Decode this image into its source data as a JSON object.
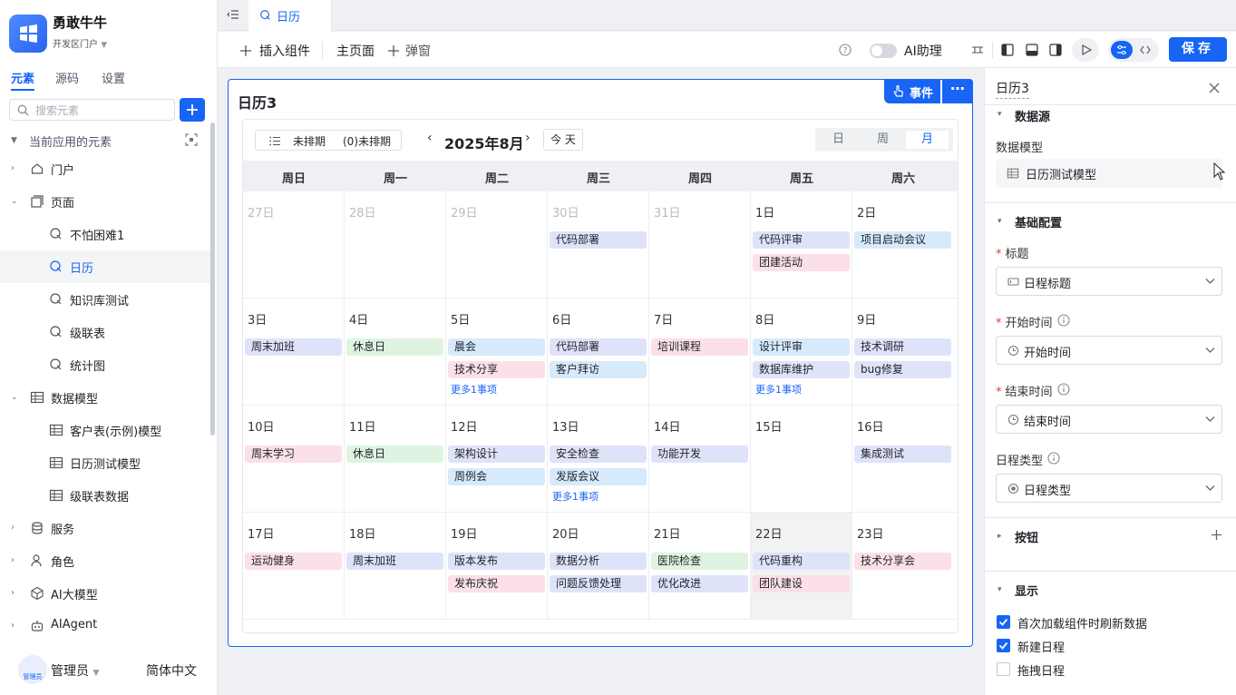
{
  "app": {
    "name": "勇敢牛牛",
    "portal": "开发区门户"
  },
  "left_tabs": [
    {
      "label": "元素"
    },
    {
      "label": "源码"
    },
    {
      "label": "设置"
    }
  ],
  "search": {
    "placeholder": "搜索元素"
  },
  "tree": {
    "section_label": "当前应用的元素",
    "items": [
      {
        "label": "门户"
      },
      {
        "label": "页面"
      },
      {
        "label": "不怕困难1"
      },
      {
        "label": "日历"
      },
      {
        "label": "知识库测试"
      },
      {
        "label": "级联表"
      },
      {
        "label": "统计图"
      },
      {
        "label": "数据模型"
      },
      {
        "label": "客户表(示例)模型"
      },
      {
        "label": "日历测试模型"
      },
      {
        "label": "级联表数据"
      },
      {
        "label": "服务"
      },
      {
        "label": "角色"
      },
      {
        "label": "AI大模型"
      },
      {
        "label": "AIAgent"
      }
    ]
  },
  "footer": {
    "user": "管理员",
    "avatar_text": "管理员",
    "language": "简体中文"
  },
  "tab": {
    "label": "日历"
  },
  "toolbar": {
    "insert": "插入组件",
    "main_page": "主页面",
    "popup": "弹窗",
    "ai_assistant": "AI助理",
    "save": "保存"
  },
  "component": {
    "title": "日历3",
    "event_button": "事件"
  },
  "calendar": {
    "unscheduled_label": "未排期",
    "unscheduled_count": "(0)未排期",
    "month_title": "2025年8月",
    "today_label": "今 天",
    "views": [
      {
        "label": "日"
      },
      {
        "label": "周"
      },
      {
        "label": "月"
      }
    ],
    "active_view": "月",
    "weekdays": [
      {
        "label": "周日"
      },
      {
        "label": "周一"
      },
      {
        "label": "周二"
      },
      {
        "label": "周三"
      },
      {
        "label": "周四"
      },
      {
        "label": "周五"
      },
      {
        "label": "周六"
      }
    ],
    "weeks": [
      [
        {
          "day": "27日",
          "other": true,
          "events": []
        },
        {
          "day": "28日",
          "other": true,
          "events": []
        },
        {
          "day": "29日",
          "other": true,
          "events": []
        },
        {
          "day": "30日",
          "other": true,
          "events": [
            {
              "title": "代码部署",
              "color": "#dfe3f9"
            }
          ]
        },
        {
          "day": "31日",
          "other": true,
          "events": []
        },
        {
          "day": "1日",
          "events": [
            {
              "title": "代码评审",
              "color": "#dfe3f9"
            },
            {
              "title": "团建活动",
              "color": "#fbe0e8"
            }
          ]
        },
        {
          "day": "2日",
          "events": [
            {
              "title": "项目启动会议",
              "color": "#d7eafb"
            }
          ]
        }
      ],
      [
        {
          "day": "3日",
          "events": [
            {
              "title": "周末加班",
              "color": "#dfe3f9"
            }
          ]
        },
        {
          "day": "4日",
          "events": [
            {
              "title": "休息日",
              "color": "#dff3e1"
            }
          ]
        },
        {
          "day": "5日",
          "events": [
            {
              "title": "晨会",
              "color": "#d7eafb"
            },
            {
              "title": "技术分享",
              "color": "#fbe0e8"
            }
          ],
          "more": "更多1事项"
        },
        {
          "day": "6日",
          "events": [
            {
              "title": "代码部署",
              "color": "#dfe3f9"
            },
            {
              "title": "客户拜访",
              "color": "#d7eafb"
            }
          ]
        },
        {
          "day": "7日",
          "events": [
            {
              "title": "培训课程",
              "color": "#fbe0e8"
            }
          ]
        },
        {
          "day": "8日",
          "events": [
            {
              "title": "设计评审",
              "color": "#d7eafb"
            },
            {
              "title": "数据库维护",
              "color": "#dfe3f9"
            }
          ],
          "more": "更多1事项"
        },
        {
          "day": "9日",
          "events": [
            {
              "title": "技术调研",
              "color": "#dfe3f9"
            },
            {
              "title": "bug修复",
              "color": "#dfe3f9"
            }
          ]
        }
      ],
      [
        {
          "day": "10日",
          "events": [
            {
              "title": "周末学习",
              "color": "#fbe0e8"
            }
          ]
        },
        {
          "day": "11日",
          "events": [
            {
              "title": "休息日",
              "color": "#dff3e1"
            }
          ]
        },
        {
          "day": "12日",
          "events": [
            {
              "title": "架构设计",
              "color": "#dfe3f9"
            },
            {
              "title": "周例会",
              "color": "#d7eafb"
            }
          ]
        },
        {
          "day": "13日",
          "events": [
            {
              "title": "安全检查",
              "color": "#dfe3f9"
            },
            {
              "title": "发版会议",
              "color": "#d7eafb"
            }
          ],
          "more": "更多1事项"
        },
        {
          "day": "14日",
          "events": [
            {
              "title": "功能开发",
              "color": "#dfe3f9"
            }
          ]
        },
        {
          "day": "15日",
          "events": []
        },
        {
          "day": "16日",
          "events": [
            {
              "title": "集成测试",
              "color": "#dfe3f9"
            }
          ]
        }
      ],
      [
        {
          "day": "17日",
          "events": [
            {
              "title": "运动健身",
              "color": "#fbe0e8"
            }
          ]
        },
        {
          "day": "18日",
          "events": [
            {
              "title": "周末加班",
              "color": "#dfe3f9"
            }
          ]
        },
        {
          "day": "19日",
          "events": [
            {
              "title": "版本发布",
              "color": "#dfe3f9"
            },
            {
              "title": "发布庆祝",
              "color": "#fbe0e8"
            }
          ]
        },
        {
          "day": "20日",
          "events": [
            {
              "title": "数据分析",
              "color": "#dfe3f9"
            },
            {
              "title": "问题反馈处理",
              "color": "#dfe3f9"
            }
          ]
        },
        {
          "day": "21日",
          "events": [
            {
              "title": "医院检查",
              "color": "#dff3e1"
            },
            {
              "title": "优化改进",
              "color": "#dfe3f9"
            }
          ]
        },
        {
          "day": "22日",
          "today": true,
          "events": [
            {
              "title": "代码重构",
              "color": "#dfe3f9"
            },
            {
              "title": "团队建设",
              "color": "#fbe0e8"
            }
          ]
        },
        {
          "day": "23日",
          "events": [
            {
              "title": "技术分享会",
              "color": "#fbe0e8"
            }
          ]
        }
      ]
    ]
  },
  "panel": {
    "title": "日历3",
    "datasource_section": "数据源",
    "model_label": "数据模型",
    "model_value": "日历测试模型",
    "basic_section": "基础配置",
    "title_label": "标题",
    "title_value": "日程标题",
    "start_label": "开始时间",
    "start_value": "开始时间",
    "end_label": "结束时间",
    "end_value": "结束时间",
    "type_label": "日程类型",
    "type_value": "日程类型",
    "buttons_section": "按钮",
    "display_section": "显示",
    "checkboxes": [
      {
        "label": "首次加载组件时刷新数据",
        "checked": true
      },
      {
        "label": "新建日程",
        "checked": true
      },
      {
        "label": "拖拽日程",
        "checked": false
      }
    ]
  },
  "colors": {
    "accent": "#1764f5",
    "event_blue": "#dfe3f9",
    "event_sky": "#d7eafb",
    "event_pink": "#fbe0e8",
    "event_green": "#dff3e1"
  }
}
